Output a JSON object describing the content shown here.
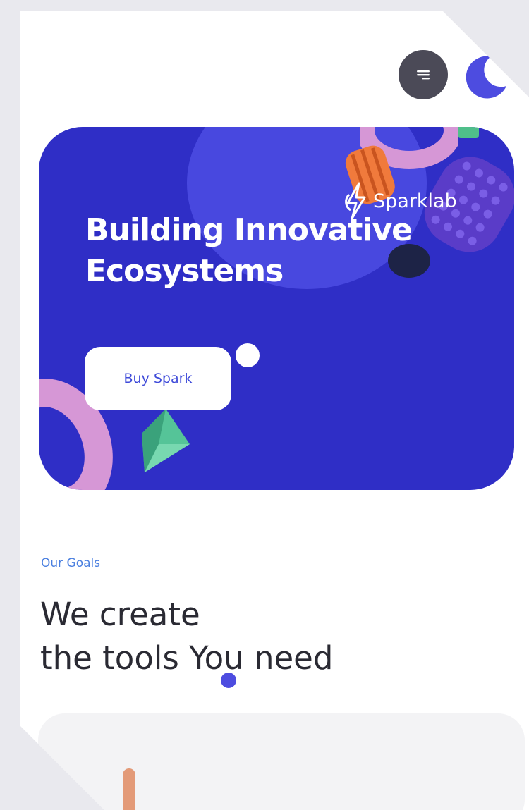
{
  "header": {
    "menu_icon": "hamburger-icon",
    "theme_icon": "moon-icon"
  },
  "hero": {
    "title_line1": "Building Innovative",
    "title_line2": "Ecosystems",
    "brand_name": "Sparklab",
    "cta_label": "Buy Spark"
  },
  "goals": {
    "eyebrow": "Our Goals",
    "title_line1": "We create",
    "title_line2": "the tools You need"
  },
  "colors": {
    "hero_bg": "#2f2ec6",
    "accent": "#4d4ce0",
    "link_blue": "#4a7fe0",
    "menu_bg": "#4b4a57"
  }
}
